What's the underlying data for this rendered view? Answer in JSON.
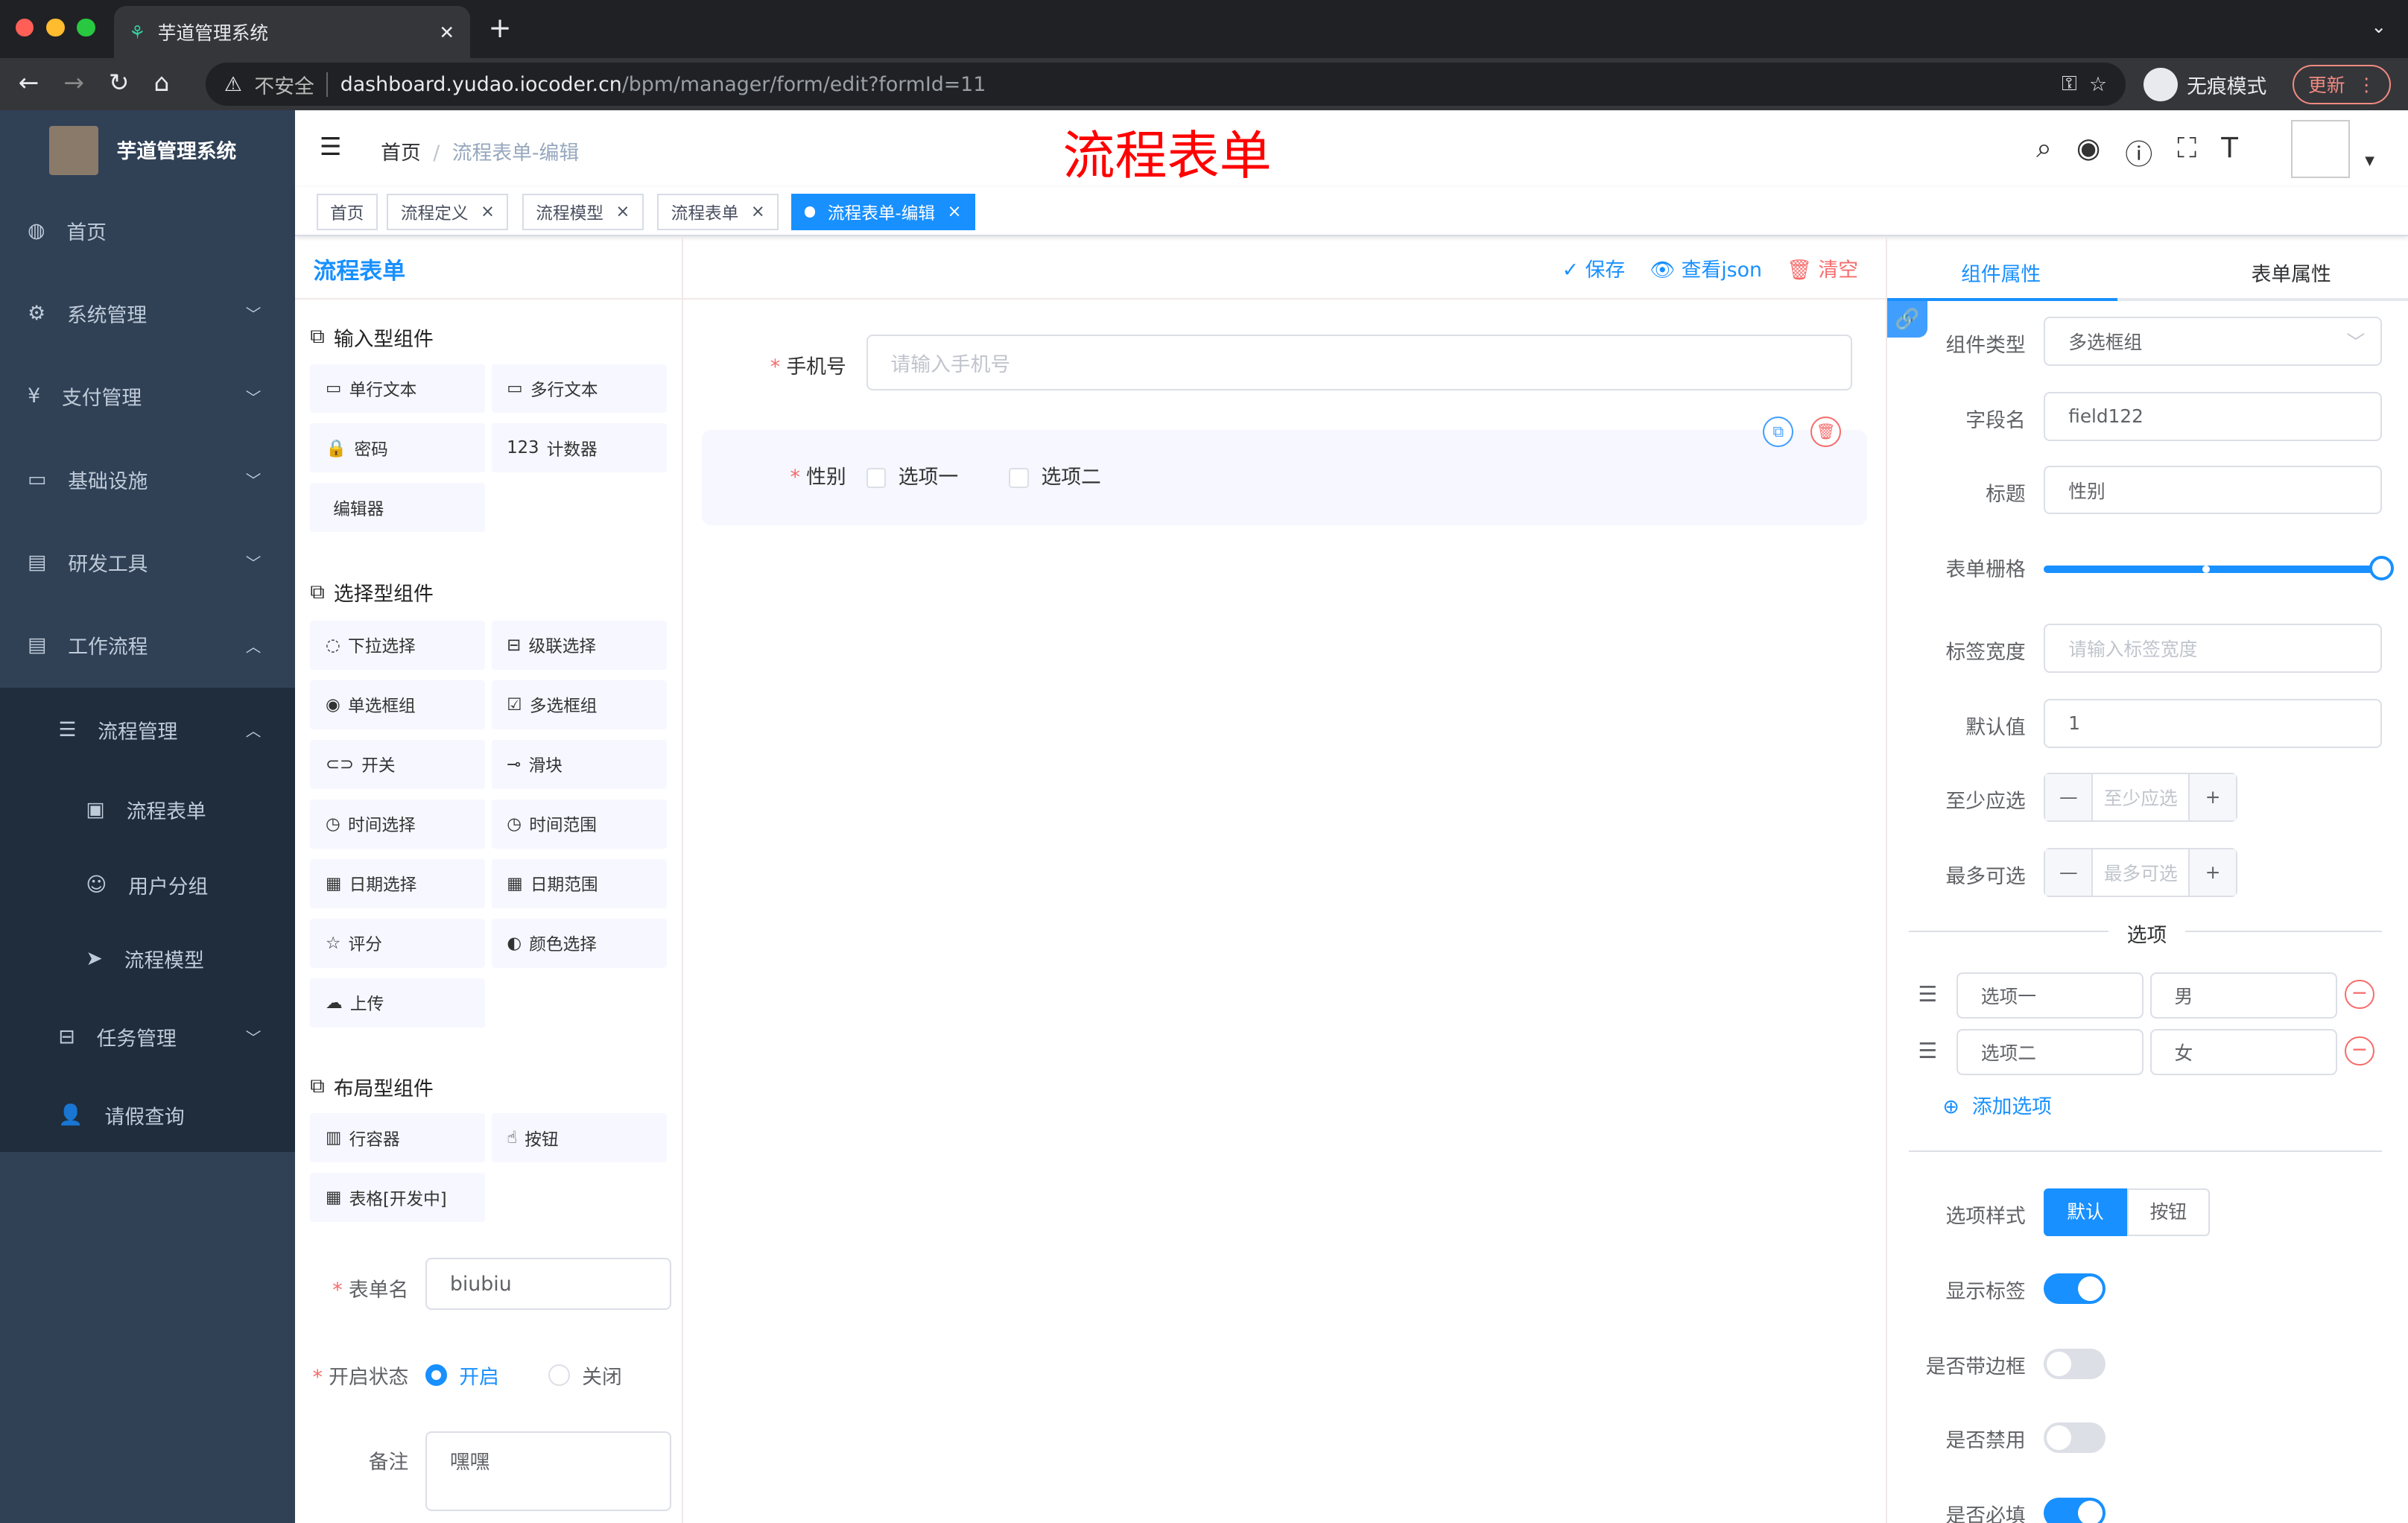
{
  "browser": {
    "tab_title": "芋道管理系统",
    "security": "不安全",
    "url_host": "dashboard.yudao.iocoder.cn",
    "url_path": "/bpm/manager/form/edit?formId=11",
    "incognito": "无痕模式",
    "update": "更新"
  },
  "sidebar": {
    "brand": "芋道管理系统",
    "items": [
      {
        "label": "首页",
        "icon": "dashboard-icon"
      },
      {
        "label": "系统管理",
        "icon": "gear-icon"
      },
      {
        "label": "支付管理",
        "icon": "yen-icon"
      },
      {
        "label": "基础设施",
        "icon": "monitor-icon"
      },
      {
        "label": "研发工具",
        "icon": "toolbox-icon"
      },
      {
        "label": "工作流程",
        "icon": "toolbox-icon"
      }
    ],
    "sub": {
      "label": "流程管理",
      "children": [
        "流程表单",
        "用户分组",
        "流程模型"
      ]
    },
    "tasks": "任务管理",
    "leave": "请假查询"
  },
  "header": {
    "breadcrumb": [
      "首页",
      "流程表单-编辑"
    ],
    "overlay_title": "流程表单"
  },
  "tags": [
    {
      "label": "首页"
    },
    {
      "label": "流程定义"
    },
    {
      "label": "流程模型"
    },
    {
      "label": "流程表单"
    },
    {
      "label": "流程表单-编辑",
      "active": true
    }
  ],
  "left": {
    "title": "流程表单",
    "groups": [
      {
        "title": "输入型组件",
        "items": [
          "单行文本",
          "多行文本",
          "密码",
          "计数器",
          "编辑器"
        ]
      },
      {
        "title": "选择型组件",
        "items": [
          "下拉选择",
          "级联选择",
          "单选框组",
          "多选框组",
          "开关",
          "滑块",
          "时间选择",
          "时间范围",
          "日期选择",
          "日期范围",
          "评分",
          "颜色选择",
          "上传"
        ]
      },
      {
        "title": "布局型组件",
        "items": [
          "行容器",
          "按钮",
          "表格[开发中]"
        ]
      }
    ],
    "form_name_label": "表单名",
    "form_name": "biubiu",
    "status_label": "开启状态",
    "status_on": "开启",
    "status_off": "关闭",
    "remark_label": "备注",
    "remark": "嘿嘿"
  },
  "toolbar": {
    "save": "保存",
    "json": "查看json",
    "clear": "清空"
  },
  "canvas": {
    "phone_label": "手机号",
    "phone_placeholder": "请输入手机号",
    "gender_label": "性别",
    "options": [
      "选项一",
      "选项二"
    ]
  },
  "right": {
    "tabs": [
      "组件属性",
      "表单属性"
    ],
    "type_label": "组件类型",
    "type_value": "多选框组",
    "field_label": "字段名",
    "field_value": "field122",
    "title_label": "标题",
    "title_value": "性别",
    "grid_label": "表单栅格",
    "grid_value": 24,
    "grid_max": 24,
    "lw_label": "标签宽度",
    "lw_placeholder": "请输入标签宽度",
    "default_label": "默认值",
    "default_value": "1",
    "min_label": "至少应选",
    "min_placeholder": "至少应选",
    "max_label": "最多可选",
    "max_placeholder": "最多可选",
    "options_title": "选项",
    "options": [
      {
        "label": "选项一",
        "value": "男"
      },
      {
        "label": "选项二",
        "value": "女"
      }
    ],
    "add_option": "添加选项",
    "style_label": "选项样式",
    "style_default": "默认",
    "style_button": "按钮",
    "show_label": "显示标签",
    "border_label": "是否带边框",
    "disabled_label": "是否禁用",
    "required_label": "是否必填",
    "show_label_on": true,
    "border_on": false,
    "disabled_on": false,
    "required_on": true
  },
  "colors": {
    "primary": "#1890ff",
    "sidebar": "#304156",
    "danger": "#f56c6c",
    "overlay_title": "#ff0000"
  }
}
